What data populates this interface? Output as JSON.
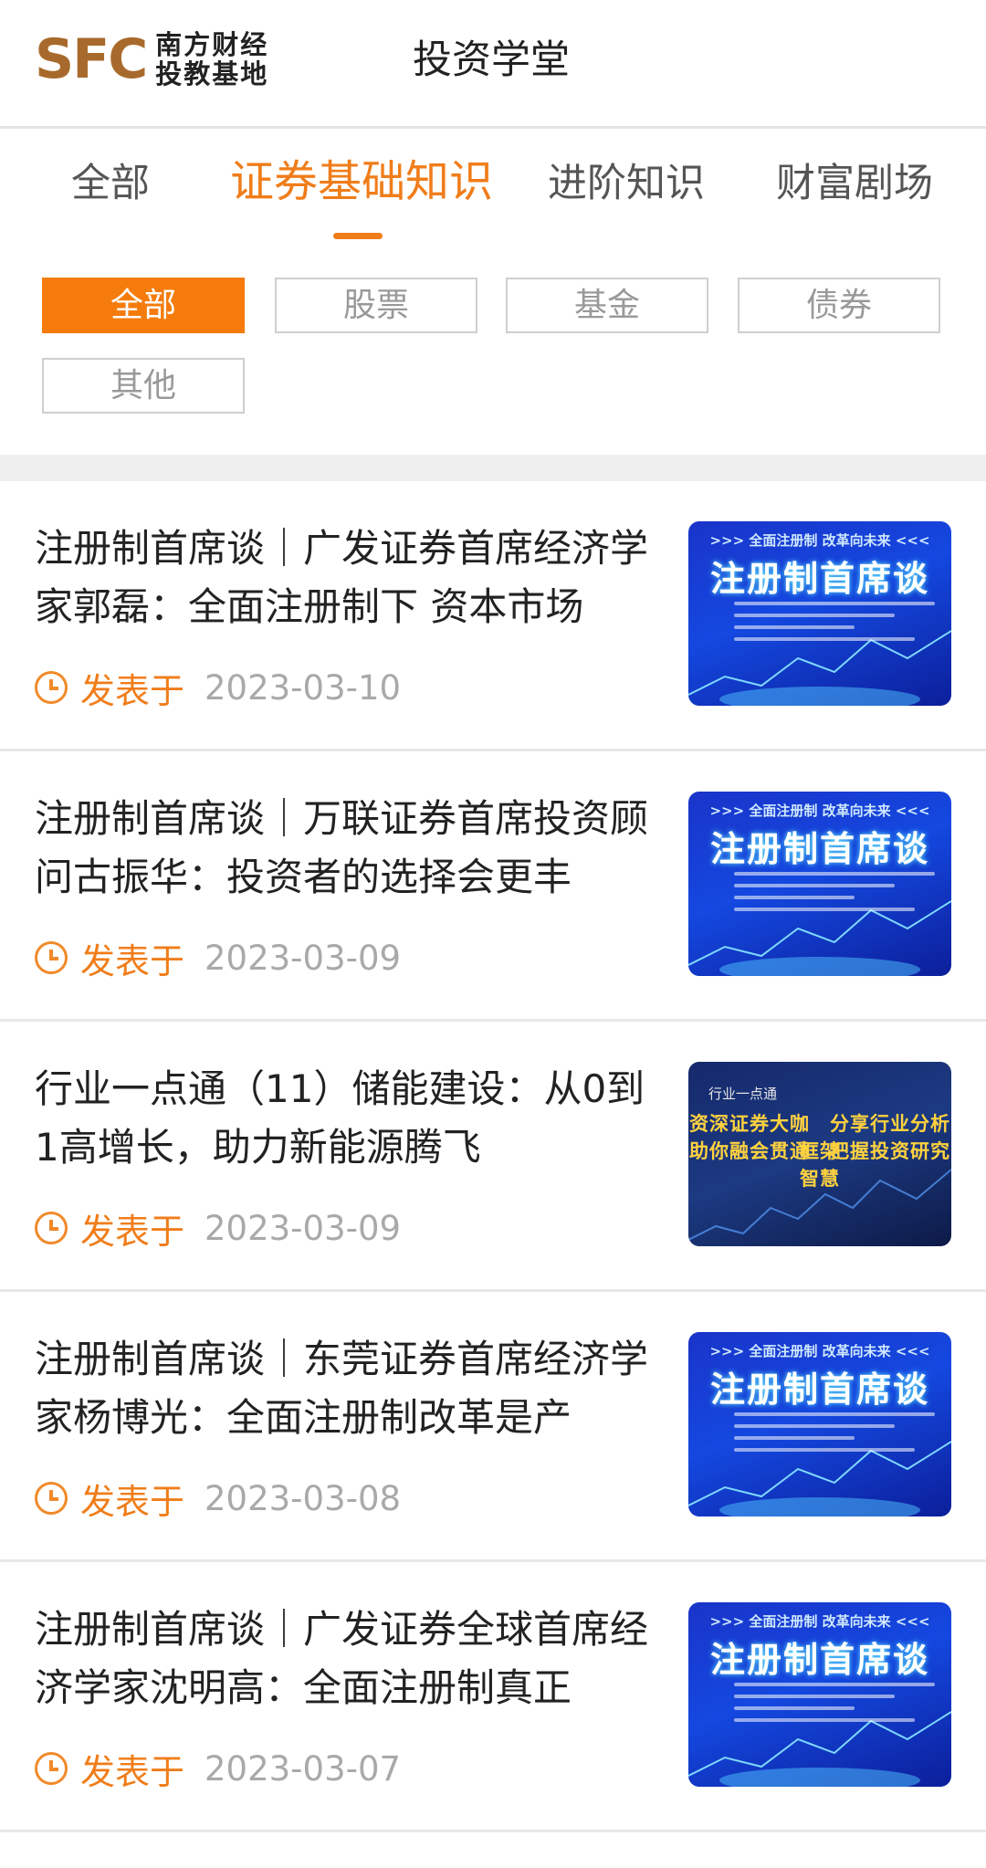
{
  "header": {
    "logo_mark": "SFC",
    "logo_line1": "南方财经",
    "logo_line2": "投教基地",
    "title": "投资学堂"
  },
  "tabs": [
    {
      "label": "全部",
      "active": false
    },
    {
      "label": "证券基础知识",
      "active": true
    },
    {
      "label": "进阶知识",
      "active": false
    },
    {
      "label": "财富剧场",
      "active": false
    }
  ],
  "filters": [
    {
      "label": "全部",
      "active": true
    },
    {
      "label": "股票",
      "active": false
    },
    {
      "label": "基金",
      "active": false
    },
    {
      "label": "债券",
      "active": false
    },
    {
      "label": "其他",
      "active": false
    }
  ],
  "meta_label": "发表于",
  "articles": [
    {
      "title": "注册制首席谈｜广发证券首席经济学家郭磊：全面注册制下 资本市场",
      "date": "2023-03-10",
      "thumb": {
        "style": "blue",
        "top": ">>> 全面注册制 改革向未来 <<<",
        "main": "注册制首席谈"
      }
    },
    {
      "title": "注册制首席谈｜万联证券首席投资顾问古振华：投资者的选择会更丰",
      "date": "2023-03-09",
      "thumb": {
        "style": "blue",
        "top": ">>> 全面注册制 改革向未来 <<<",
        "main": "注册制首席谈"
      }
    },
    {
      "title": "行业一点通（11）储能建设：从0到1高增长，助力新能源腾飞",
      "date": "2023-03-09",
      "thumb": {
        "style": "navy",
        "top": "行业一点通",
        "line1": "资深证券大咖　分享行业分析框架",
        "line2": "助你融会贯通　把握投资研究智慧"
      }
    },
    {
      "title": "注册制首席谈｜东莞证券首席经济学家杨博光：全面注册制改革是产",
      "date": "2023-03-08",
      "thumb": {
        "style": "blue",
        "top": ">>> 全面注册制 改革向未来 <<<",
        "main": "注册制首席谈"
      }
    },
    {
      "title": "注册制首席谈｜广发证券全球首席经济学家沈明高：全面注册制真正",
      "date": "2023-03-07",
      "thumb": {
        "style": "blue",
        "top": ">>> 全面注册制 改革向未来 <<<",
        "main": "注册制首席谈"
      }
    }
  ],
  "colors": {
    "accent": "#f07d1a",
    "chip_active": "#f57c0c",
    "date_gray": "#a9a9a9",
    "divider": "#e8e8e8"
  }
}
